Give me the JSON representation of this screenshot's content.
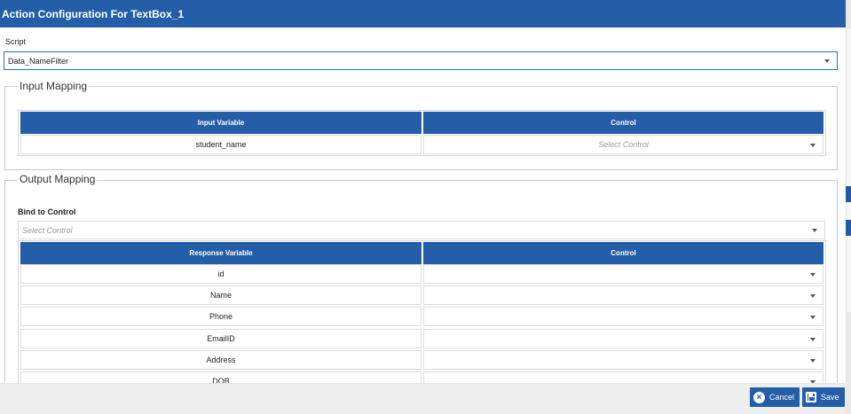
{
  "dialog": {
    "title": "Action Configuration For TextBox_1"
  },
  "script": {
    "label": "Script",
    "selected": "Data_NameFilter"
  },
  "input_mapping": {
    "legend": "Input Mapping",
    "headers": [
      "Input Variable",
      "Control"
    ],
    "rows": [
      {
        "variable": "student_name",
        "control_placeholder": "Select Control"
      }
    ]
  },
  "output_mapping": {
    "legend": "Output Mapping",
    "bind_label": "Bind to Control",
    "bind_placeholder": "Select Control",
    "headers": [
      "Response Variable",
      "Control"
    ],
    "rows": [
      {
        "variable": "id",
        "control": ""
      },
      {
        "variable": "Name",
        "control": ""
      },
      {
        "variable": "Phone",
        "control": ""
      },
      {
        "variable": "EmailID",
        "control": ""
      },
      {
        "variable": "Address",
        "control": ""
      },
      {
        "variable": "DOB",
        "control": ""
      }
    ]
  },
  "footer": {
    "cancel_label": "Cancel",
    "save_label": "Save"
  },
  "colors": {
    "accent": "#245ea8"
  }
}
